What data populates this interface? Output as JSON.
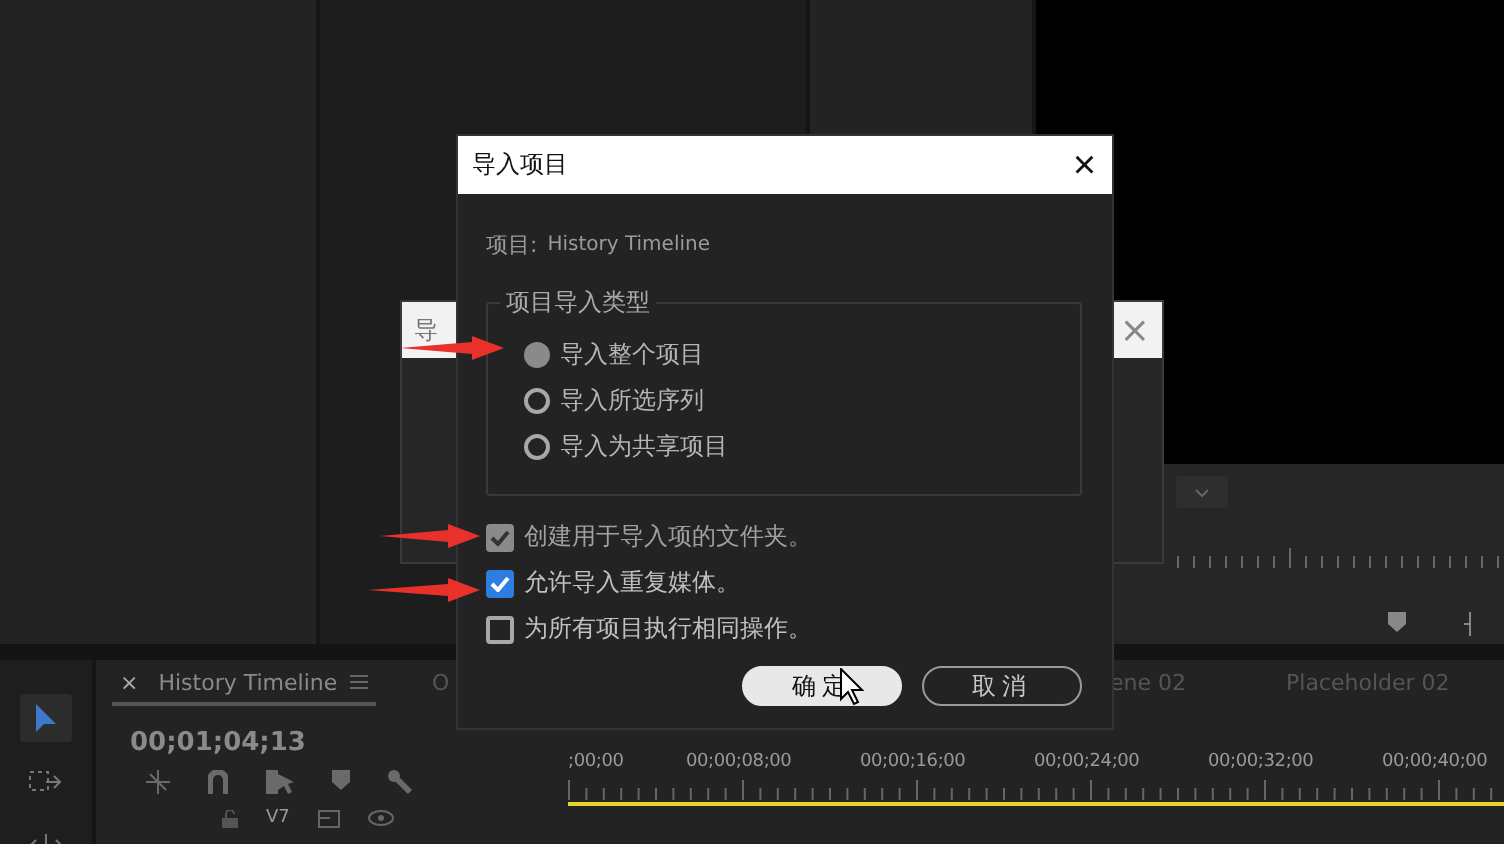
{
  "timeline": {
    "tabs": [
      {
        "label": "History Timeline",
        "selected": true
      },
      {
        "label": "O",
        "selected": false
      },
      {
        "label": "ene 02",
        "selected": false
      },
      {
        "label": "Placeholder 02",
        "selected": false
      }
    ],
    "close": "×",
    "timecode": "00;01;04;13",
    "track": "V7",
    "ruler": [
      ";00;00",
      "00;00;08;00",
      "00;00;16;00",
      "00;00;24;00",
      "00;00;32;00",
      "00;00;40;00"
    ]
  },
  "back_dialog": {
    "title": "导",
    "close": "×"
  },
  "dialog": {
    "title": "导入项目",
    "close": "×",
    "project_label": "项目:",
    "project_name": "History Timeline",
    "group_title": "项目导入类型",
    "options": [
      {
        "label": "导入整个项目",
        "selected": true
      },
      {
        "label": "导入所选序列",
        "selected": false
      },
      {
        "label": "导入为共享项目",
        "selected": false
      }
    ],
    "checkboxes": [
      {
        "label": "创建用于导入项的文件夹。",
        "checked": true,
        "disabled": true
      },
      {
        "label": "允许导入重复媒体。",
        "checked": true,
        "disabled": false
      },
      {
        "label": "为所有项目执行相同操作。",
        "checked": false,
        "disabled": false
      }
    ],
    "buttons": [
      {
        "label": "确定",
        "kind": "primary"
      },
      {
        "label": "取消",
        "kind": "secondary"
      }
    ]
  }
}
